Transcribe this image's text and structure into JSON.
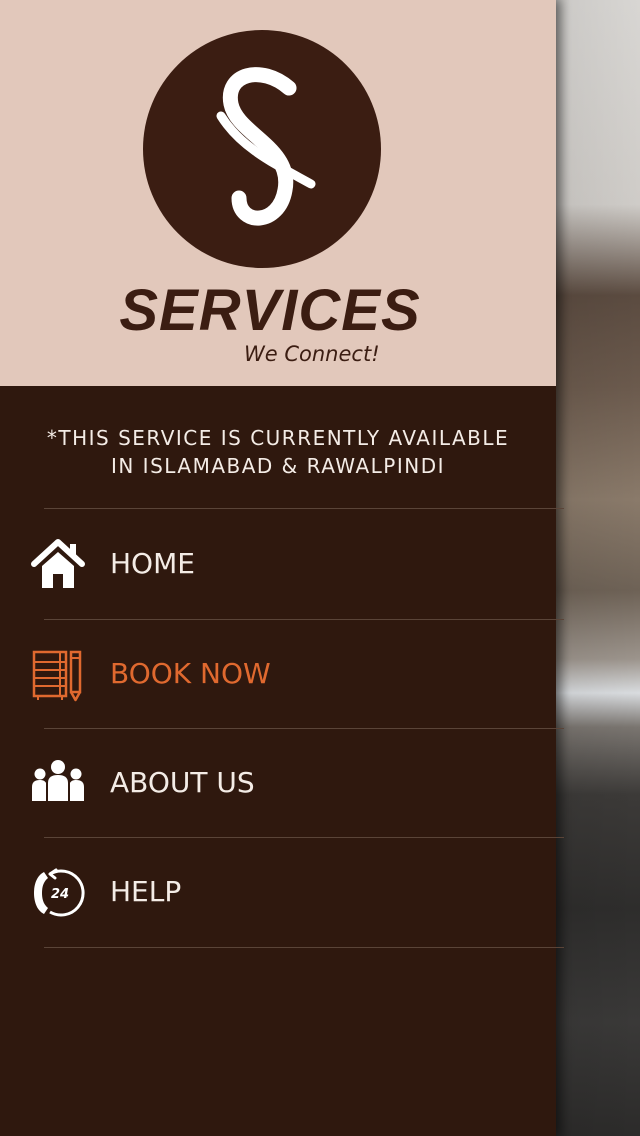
{
  "brand": {
    "name": "SERVICES",
    "tagline": "We Connect!"
  },
  "notice": {
    "line1": "*THIS SERVICE IS CURRENTLY AVAILABLE",
    "line2": "IN ISLAMABAD & RAWALPINDI"
  },
  "menu": {
    "items": [
      {
        "label": "HOME",
        "icon": "home-icon",
        "active": false
      },
      {
        "label": "BOOK NOW",
        "icon": "notebook-pen-icon",
        "active": true
      },
      {
        "label": "ABOUT US",
        "icon": "group-icon",
        "active": false
      },
      {
        "label": "HELP",
        "icon": "support-24-phone-icon",
        "active": false
      }
    ]
  },
  "colors": {
    "header_background": "#e2c8bb",
    "drawer_background": "#2f180e",
    "logo_brown": "#3b1d12",
    "active_accent": "#e0692f",
    "menu_text": "#f4ece6"
  }
}
